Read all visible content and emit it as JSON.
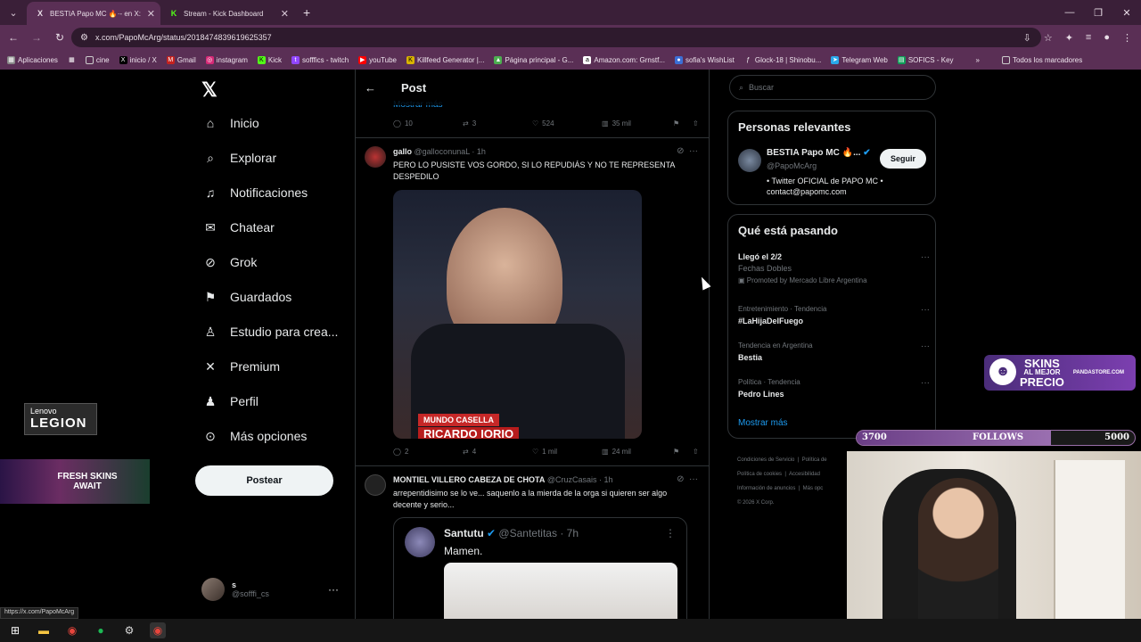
{
  "browser": {
    "tabs": [
      {
        "title": "BESTIA Papo MC 🔥·- en X: \"F",
        "favicon": "X",
        "active": true
      },
      {
        "title": "Stream - Kick Dashboard",
        "favicon": "K",
        "active": false
      }
    ],
    "url": "x.com/PapoMcArg/status/2018474839619625357",
    "bookmarks": [
      "Aplicaciones",
      "cine",
      "inicio / X",
      "Gmail",
      "instagram",
      "Kick",
      "sofffics - twitch",
      "youTube",
      "Killfeed Generator |...",
      "Página principal - G...",
      "Amazon.com: Grnstf...",
      "sofia's WishList",
      "Glock-18 | Shinobu...",
      "Telegram Web",
      "SOFICS - Key"
    ],
    "bookmarks_all": "Todos los marcadores",
    "status_url": "https://x.com/PapoMcArg"
  },
  "nav": {
    "items": [
      {
        "label": "Inicio",
        "icon": "home-icon"
      },
      {
        "label": "Explorar",
        "icon": "search-icon"
      },
      {
        "label": "Notificaciones",
        "icon": "bell-icon"
      },
      {
        "label": "Chatear",
        "icon": "mail-icon"
      },
      {
        "label": "Grok",
        "icon": "grok-icon"
      },
      {
        "label": "Guardados",
        "icon": "bookmark-icon"
      },
      {
        "label": "Estudio para crea...",
        "icon": "studio-icon"
      },
      {
        "label": "Premium",
        "icon": "x-premium-icon"
      },
      {
        "label": "Perfil",
        "icon": "person-icon"
      },
      {
        "label": "Más opciones",
        "icon": "more-circle-icon"
      }
    ],
    "post_button": "Postear",
    "account": {
      "name": "s",
      "handle": "@sofffi_cs"
    }
  },
  "feed": {
    "header": "Post",
    "mostrar_mas": "Mostrar más",
    "first_actions": {
      "replies": "10",
      "reposts": "3",
      "likes": "524",
      "views": "35 mil"
    },
    "tweets": [
      {
        "name": "gallo",
        "handle": "@galloconunaL",
        "time": "· 1h",
        "text": "PERO LO PUSISTE VOS GORDO, SI LO REPUDIÁS Y NO TE REPRESENTA DESPEDILO",
        "media_caption_1": "MUNDO CASELLA",
        "media_caption_2": "RICARDO IORIO",
        "actions": {
          "replies": "2",
          "reposts": "4",
          "likes": "1 mil",
          "views": "24 mil"
        }
      },
      {
        "name": "MONTIEL VILLERO CABEZA DE CHOTA",
        "handle": "@CruzCasais",
        "time": "· 1h",
        "text": "arrepentidisimo se lo ve... saquenlo a la mierda de la orga si quieren ser algo decente y serio...",
        "quote": {
          "name": "Santutu",
          "handle": "@Santetitas",
          "time": "· 7h",
          "text": "Mamen."
        }
      }
    ]
  },
  "right": {
    "search_placeholder": "Buscar",
    "relevant_title": "Personas relevantes",
    "relevant": {
      "name": "BESTIA Papo MC 🔥...",
      "handle": "@PapoMcArg",
      "bio": "• Twitter OFICIAL de PAPO MC • contact@papomc.com",
      "follow": "Seguir"
    },
    "trends_title": "Qué está pasando",
    "trends": [
      {
        "category": "",
        "title": "Llegó el 2/2",
        "sub": "Fechas Dobles",
        "promo": "Promoted by Mercado Libre Argentina"
      },
      {
        "category": "Entretenimiento · Tendencia",
        "title": "#LaHijaDelFuego",
        "sub": "",
        "promo": ""
      },
      {
        "category": "Tendencia en Argentina",
        "title": "Bestia",
        "sub": "",
        "promo": ""
      },
      {
        "category": "Política · Tendencia",
        "title": "Pedro Lines",
        "sub": "",
        "promo": ""
      }
    ],
    "show_more": "Mostrar más",
    "footer": [
      "Condiciones de Servicio",
      "Política de",
      "Política de cookies",
      "Accesibilidad",
      "Información de anuncios",
      "Más opc",
      "© 2026 X Corp."
    ]
  },
  "overlays": {
    "legion_brand": "Lenovo",
    "legion_name": "LEGION",
    "fresh_skins": "FRESH SKINS AWAIT",
    "panda_line1": "SKINS",
    "panda_line2": "AL MEJOR",
    "panda_line3": "PRECIO",
    "panda_site": "PANDASTORE.COM",
    "follows_start": "3700",
    "follows_label": "FOLLOWS",
    "follows_goal": "5000",
    "follows_progress": 0.7
  }
}
